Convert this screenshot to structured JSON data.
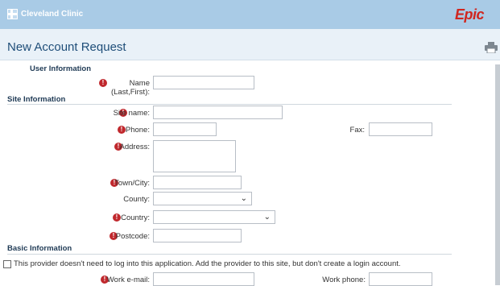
{
  "app": {
    "brand": "Cleveland Clinic",
    "vendor": "Epic"
  },
  "page": {
    "title": "New Account Request"
  },
  "sections": {
    "user_info": "User Information",
    "site_info": "Site Information",
    "basic_info": "Basic Information"
  },
  "fields": {
    "name_label": "Name (Last,First):",
    "site_name_label": "Site name:",
    "phone_label": "Phone:",
    "fax_label": "Fax:",
    "address_label": "Address:",
    "town_label": "Town/City:",
    "county_label": "County:",
    "country_label": "Country:",
    "postcode_label": "Postcode:",
    "work_email_label": "Work e-mail:",
    "work_phone_label": "Work phone:"
  },
  "checkbox": {
    "label": "This provider doesn't need to log into this application. Add the provider to this site, but don't create a login account."
  },
  "icons": {
    "required": "!",
    "chevron": "⌄",
    "print": "print-icon"
  },
  "colors": {
    "topbar": "#a9cbe6",
    "title": "#1f4e79",
    "required": "#c0282d",
    "epic": "#d0261f"
  }
}
